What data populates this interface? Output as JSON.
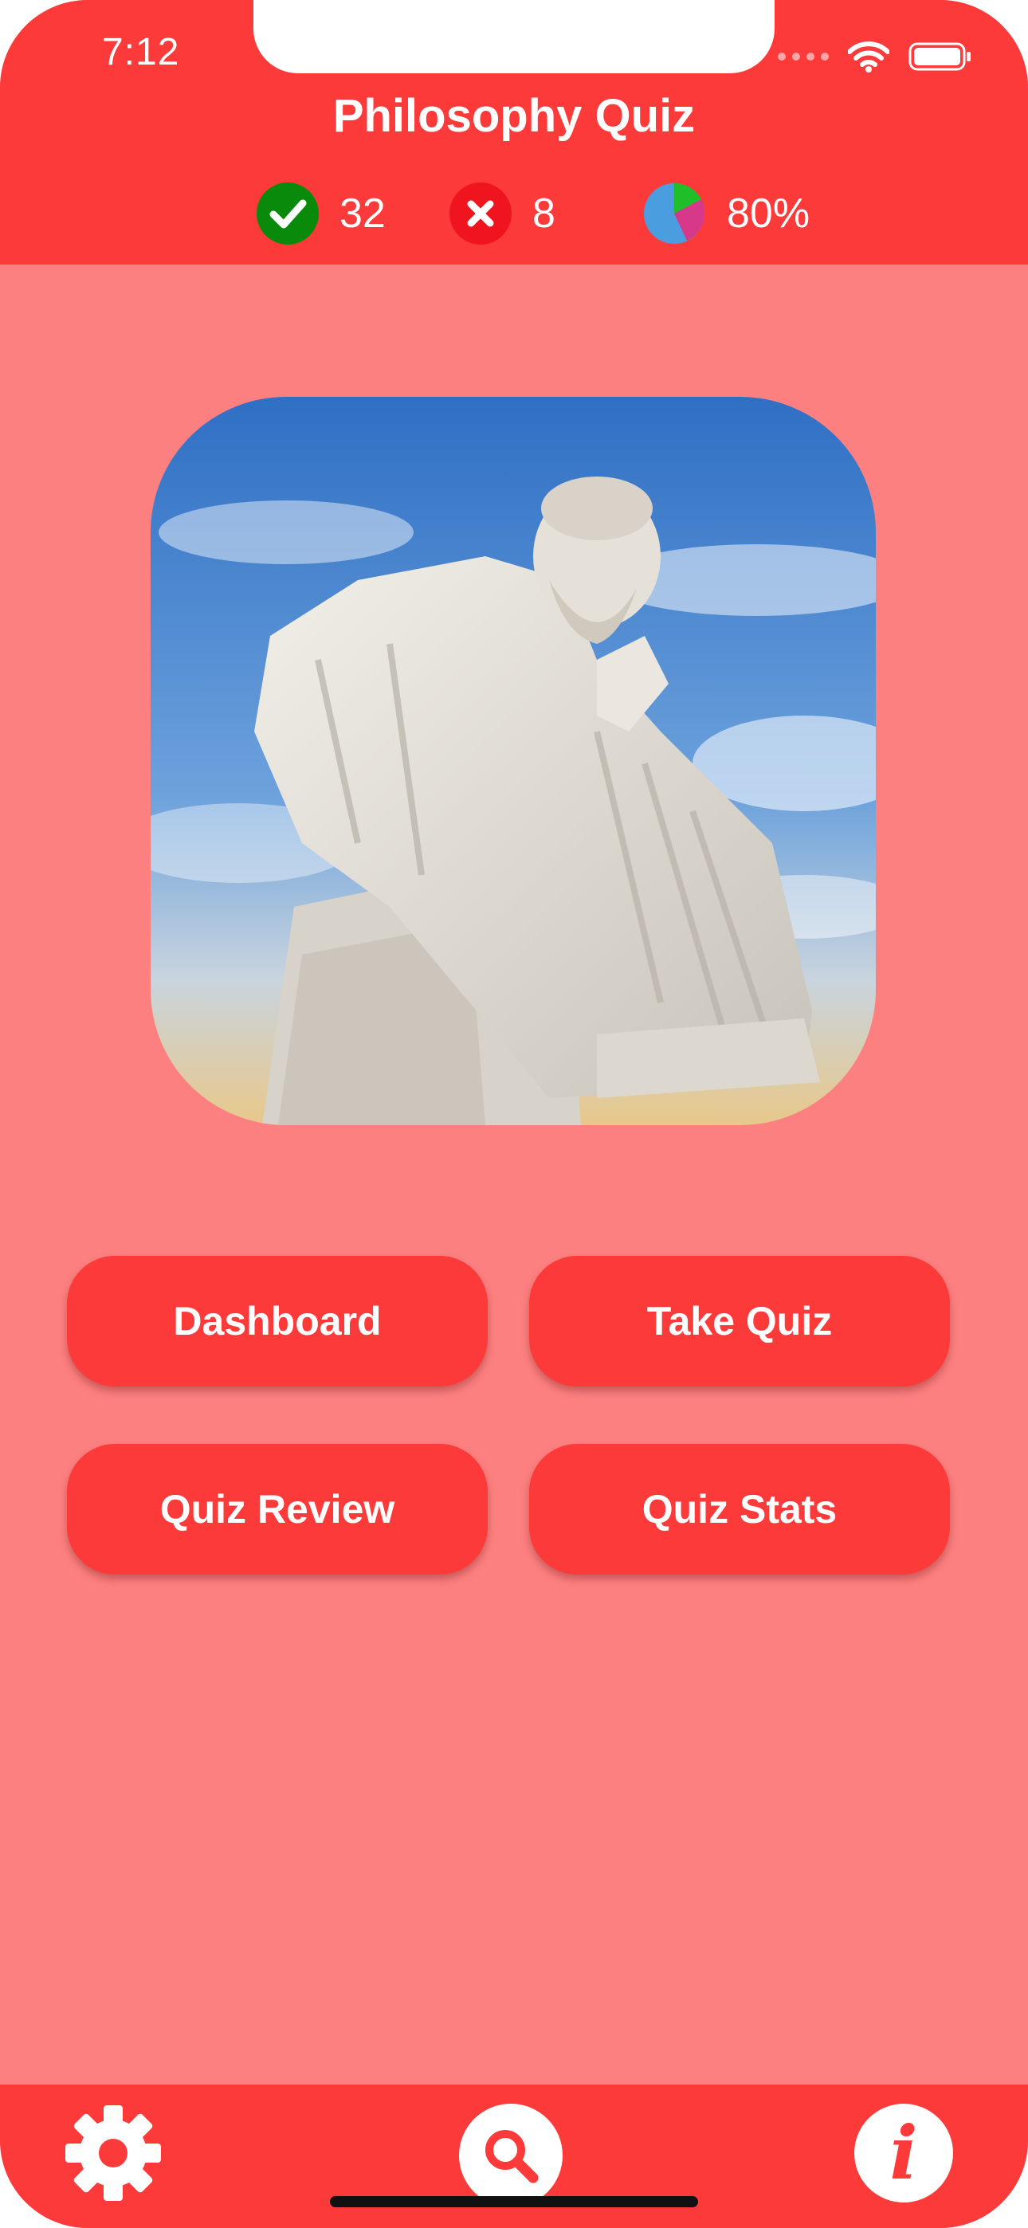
{
  "status_bar": {
    "time": "7:12",
    "icons": [
      "signal-dots-icon",
      "wifi-icon",
      "battery-icon"
    ]
  },
  "header": {
    "title": "Philosophy Quiz"
  },
  "stats": {
    "correct": {
      "icon": "checkmark-icon",
      "value": "32",
      "color": "#0a8a0a"
    },
    "wrong": {
      "icon": "cross-icon",
      "value": "8",
      "color": "#f0141e"
    },
    "score": {
      "icon": "pie-chart-icon",
      "value": "80%"
    }
  },
  "hero": {
    "image": "socrates-statue-image"
  },
  "buttons": {
    "dashboard": "Dashboard",
    "take_quiz": "Take Quiz",
    "quiz_review": "Quiz Review",
    "quiz_stats": "Quiz Stats"
  },
  "bottom_bar": {
    "left_icon": "gear-icon",
    "center_icon": "search-icon",
    "right_icon": "info-icon",
    "info_glyph": "i"
  },
  "colors": {
    "accent": "#fc3a3a",
    "background": "#fd8080",
    "text": "#ffffff"
  }
}
